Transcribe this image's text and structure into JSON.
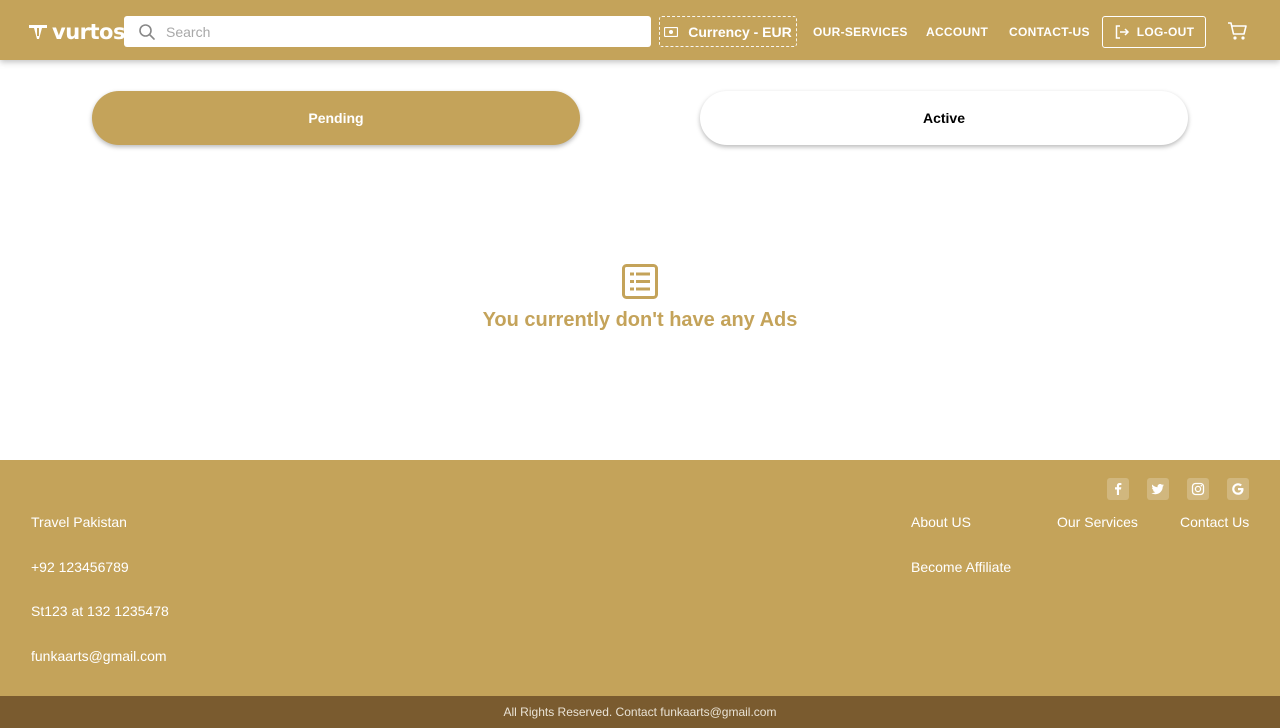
{
  "header": {
    "logo_text": "vurtos",
    "search_placeholder": "Search",
    "currency_label": "Currency - EUR",
    "nav": {
      "services": "OUR-SERVICES",
      "account": "ACCOUNT",
      "contact": "CONTACT-US"
    },
    "logout_label": "LOG-OUT"
  },
  "tabs": {
    "pending": "Pending",
    "active": "Active"
  },
  "empty_state": {
    "message": "You currently don't have any Ads"
  },
  "footer": {
    "company": "Travel Pakistan",
    "phone": "+92 123456789",
    "address": "St123 at 132 1235478",
    "email": "funkaarts@gmail.com",
    "links": {
      "about": "About US",
      "services": "Our Services",
      "contact": "Contact Us",
      "affiliate": "Become Affiliate"
    },
    "copyright": "All Rights Reserved. Contact funkaarts@gmail.com"
  },
  "colors": {
    "brand": "#c4a35a",
    "bottom_bar": "#7a5b2f"
  }
}
